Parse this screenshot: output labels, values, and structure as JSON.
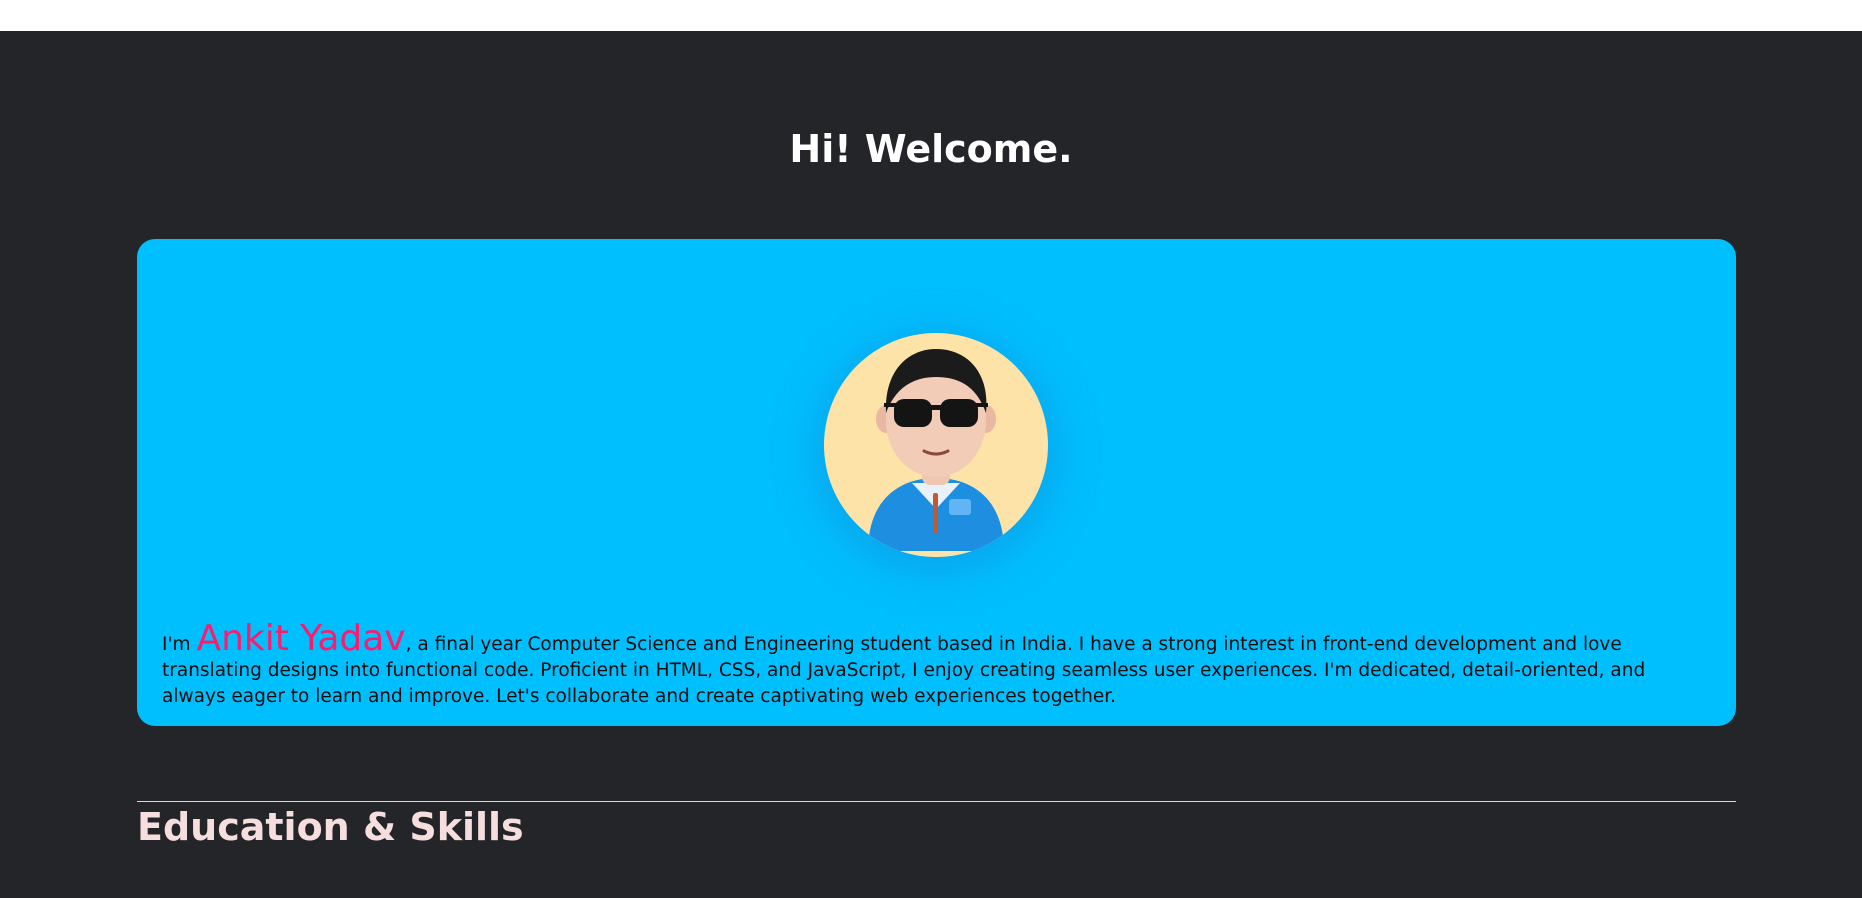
{
  "hero": {
    "heading": "Hi! Welcome."
  },
  "about": {
    "intro_prefix": "I'm ",
    "name": "Ankit Yadav",
    "bio": ", a final year Computer Science and Engineering student based in India. I have a strong interest in front-end development and love translating designs into functional code. Proficient in HTML, CSS, and JavaScript, I enjoy creating seamless user experiences. I'm dedicated, detail-oriented, and always eager to learn and improve. Let's collaborate and create captivating web experiences together.",
    "avatar_icon": "avatar-with-sunglasses",
    "colors": {
      "card_bg": "#00bfff",
      "name": "#ff1a6e",
      "avatar_bg": "#fde3a7"
    }
  },
  "education": {
    "title": "Education & Skills"
  },
  "colors": {
    "page_bg": "#242529"
  }
}
